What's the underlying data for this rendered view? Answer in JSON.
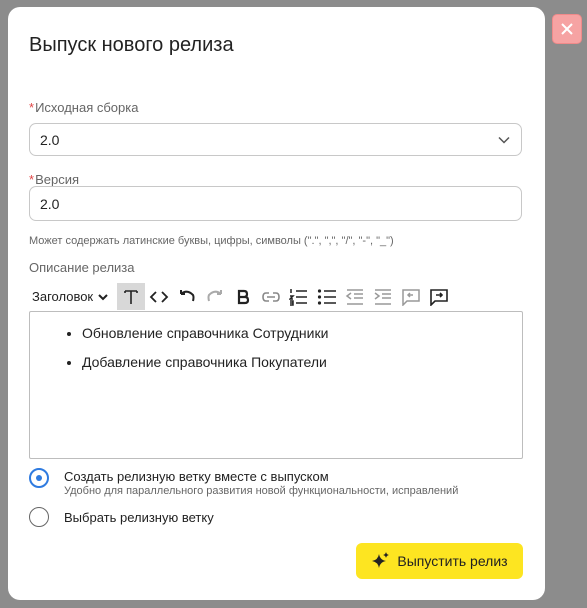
{
  "dialog": {
    "title": "Выпуск нового релиза",
    "close_icon": "close-icon"
  },
  "build": {
    "required_mark": "*",
    "label": "Исходная сборка",
    "value": "2.0"
  },
  "version": {
    "required_mark": "*",
    "label": "Версия",
    "value": "2.0",
    "hint": "Может содержать латинские буквы, цифры, символы (\".\", \",\", \"/\", \"-\", \"_\")"
  },
  "description": {
    "label": "Описание релиза",
    "heading_select": "Заголовок",
    "toolbar_icons": [
      "text-icon",
      "code-icon",
      "undo-icon",
      "redo-icon",
      "bold-icon",
      "link-icon",
      "ordered-list-icon",
      "bullet-list-icon",
      "outdent-icon",
      "indent-icon",
      "comment-left-icon",
      "comment-right-icon"
    ],
    "items": [
      "Обновление справочника Сотрудники",
      "Добавление справочника Покупатели"
    ]
  },
  "branch_options": {
    "create": {
      "label": "Создать релизную ветку вместе с выпуском",
      "sublabel": "Удобно для параллельного развития новой функциональности, исправлений",
      "selected": true
    },
    "choose": {
      "label": "Выбрать релизную ветку",
      "selected": false
    }
  },
  "release_button": {
    "label": "Выпустить релиз",
    "icon": "sparkle-icon"
  },
  "colors": {
    "accent": "#2f7be0",
    "primary_button": "#fde521",
    "close_button": "#f6a3a3",
    "required": "#e04545"
  }
}
